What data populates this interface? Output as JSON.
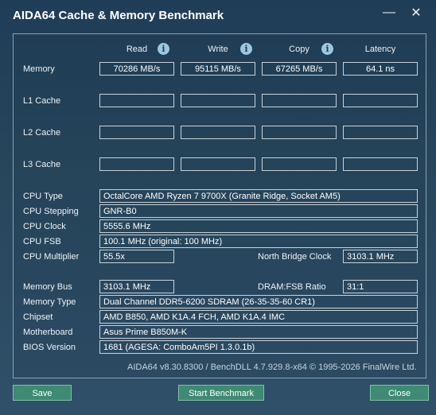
{
  "window": {
    "title": "AIDA64 Cache & Memory Benchmark",
    "minimize_glyph": "—",
    "close_glyph": "✕"
  },
  "columns": {
    "read": "Read",
    "write": "Write",
    "copy": "Copy",
    "latency": "Latency",
    "info_glyph": "i"
  },
  "rows": {
    "memory": {
      "label": "Memory",
      "read": "70286 MB/s",
      "write": "95115 MB/s",
      "copy": "67265 MB/s",
      "latency": "64.1 ns"
    },
    "l1": {
      "label": "L1 Cache",
      "read": "",
      "write": "",
      "copy": "",
      "latency": ""
    },
    "l2": {
      "label": "L2 Cache",
      "read": "",
      "write": "",
      "copy": "",
      "latency": ""
    },
    "l3": {
      "label": "L3 Cache",
      "read": "",
      "write": "",
      "copy": "",
      "latency": ""
    }
  },
  "cpu": {
    "type_label": "CPU Type",
    "type": "OctalCore AMD Ryzen 7 9700X  (Granite Ridge, Socket AM5)",
    "stepping_label": "CPU Stepping",
    "stepping": "GNR-B0",
    "clock_label": "CPU Clock",
    "clock": "5555.6 MHz",
    "fsb_label": "CPU FSB",
    "fsb": "100.1 MHz  (original: 100 MHz)",
    "multiplier_label": "CPU Multiplier",
    "multiplier": "55.5x",
    "nb_clock_label": "North Bridge Clock",
    "nb_clock": "3103.1 MHz"
  },
  "system": {
    "mem_bus_label": "Memory Bus",
    "mem_bus": "3103.1 MHz",
    "dram_fsb_label": "DRAM:FSB Ratio",
    "dram_fsb": "31:1",
    "mem_type_label": "Memory Type",
    "mem_type": "Dual Channel DDR5-6200 SDRAM  (26-35-35-60 CR1)",
    "chipset_label": "Chipset",
    "chipset": "AMD B850, AMD K1A.4 FCH, AMD K1A.4 IMC",
    "motherboard_label": "Motherboard",
    "motherboard": "Asus Prime B850M-K",
    "bios_label": "BIOS Version",
    "bios": "1681  (AGESA: ComboAm5PI 1.3.0.1b)"
  },
  "footer": {
    "text": "AIDA64 v8.30.8300 / BenchDLL 4.7.929.8-x64  © 1995-2026 FinalWire Ltd."
  },
  "buttons": {
    "save": "Save",
    "start": "Start Benchmark",
    "close": "Close"
  }
}
